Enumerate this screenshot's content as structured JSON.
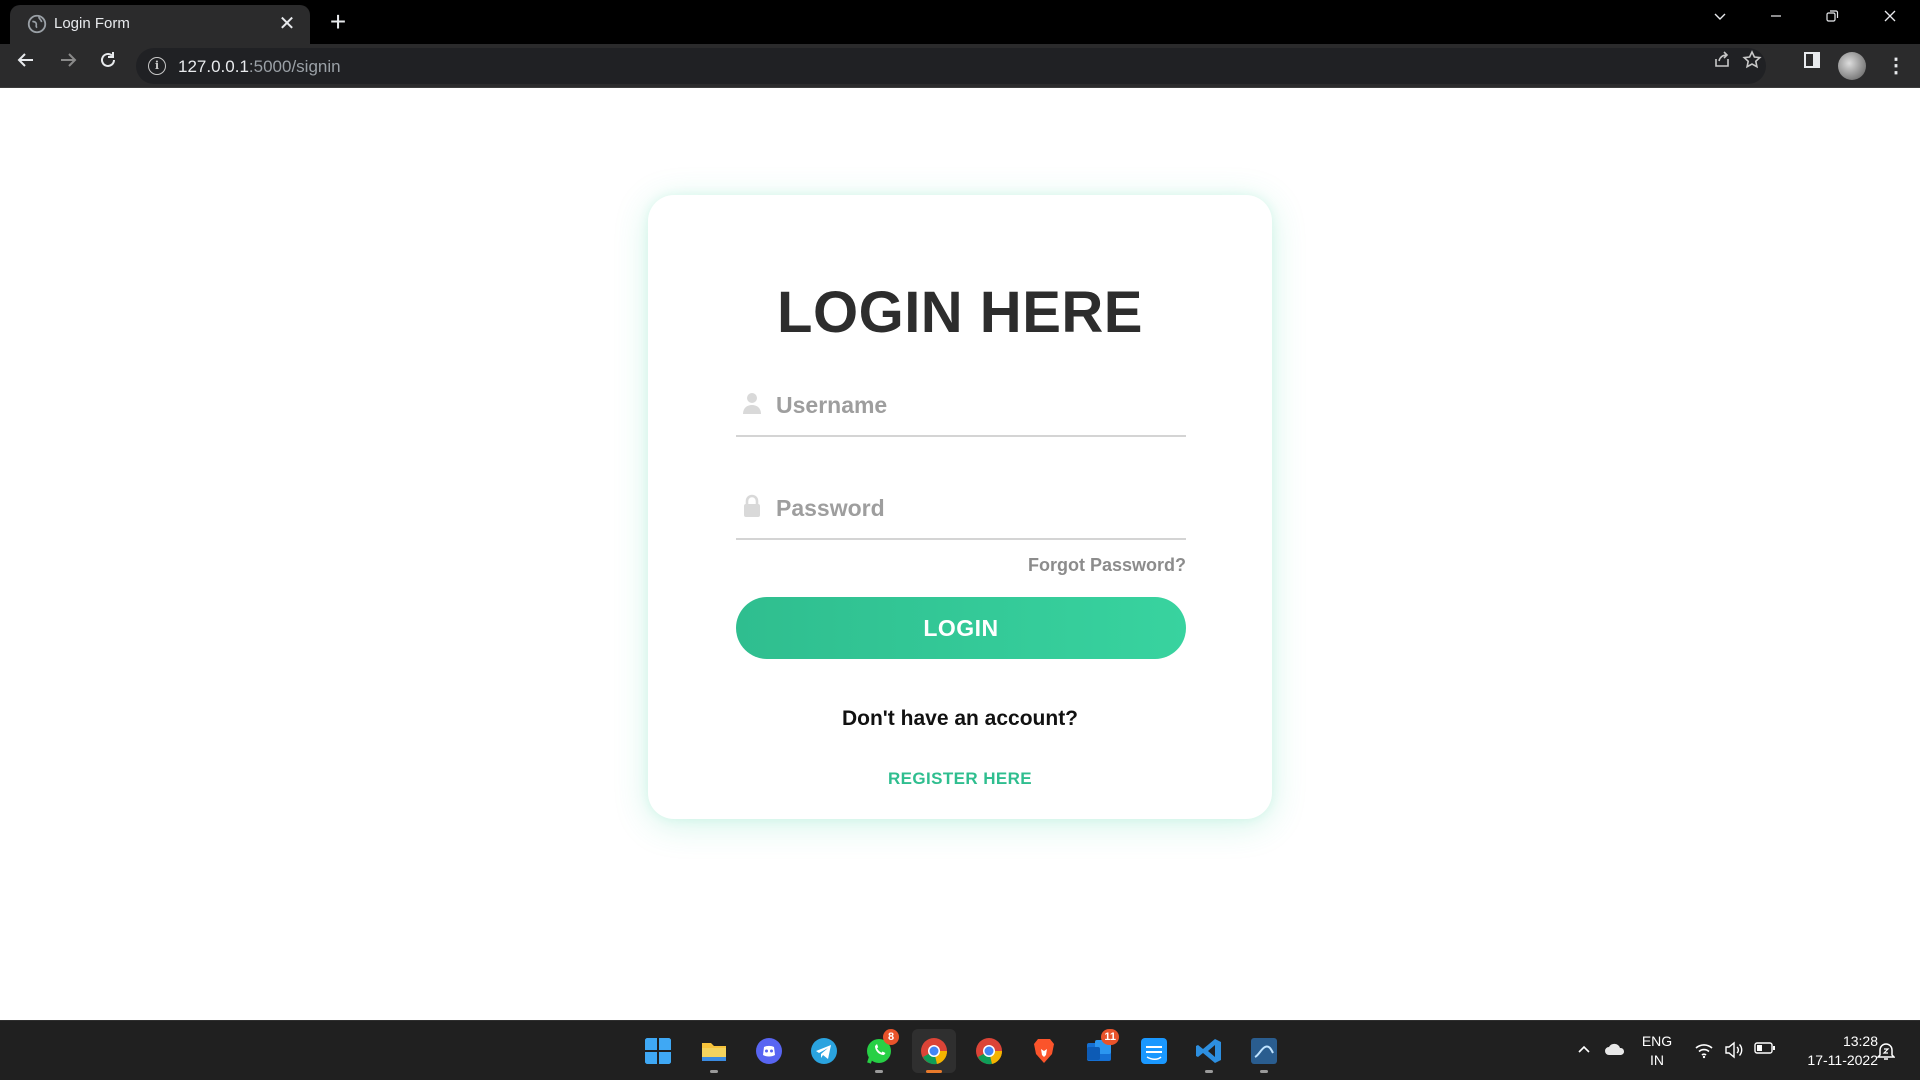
{
  "browser": {
    "tab_title": "Login Form",
    "tab_close": "✕",
    "new_tab": "+",
    "url_host": "127.0.0.1",
    "url_path": ":5000/signin"
  },
  "page": {
    "heading": "LOGIN HERE",
    "username_placeholder": "Username",
    "password_placeholder": "Password",
    "forgot_label": "Forgot Password?",
    "login_label": "LOGIN",
    "no_account_text": "Don't have an account?",
    "register_label": "REGISTER HERE"
  },
  "taskbar": {
    "whatsapp_badge": "8",
    "mail_badge": "11",
    "lang_line1": "ENG",
    "lang_line2": "IN",
    "time": "13:28",
    "date": "17-11-2022"
  },
  "colors": {
    "accent": "#38d39f",
    "accent_dark": "#2fbe8f",
    "heading": "#2d2d2d",
    "chrome_bg": "#000000",
    "toolbar_bg": "#2b2b2c",
    "taskbar_bg": "#202020"
  }
}
